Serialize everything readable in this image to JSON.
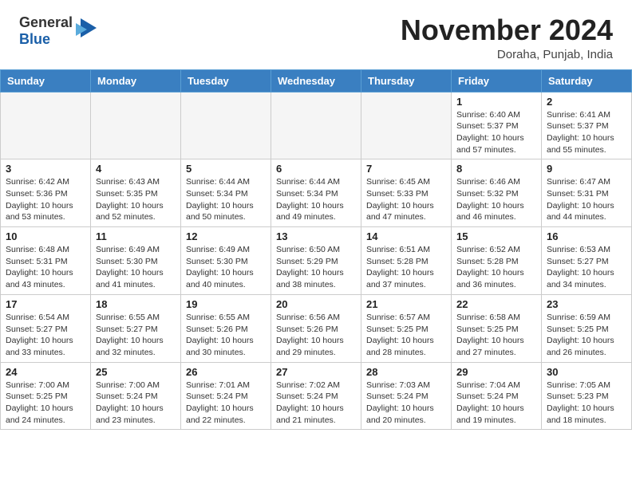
{
  "header": {
    "logo_general": "General",
    "logo_blue": "Blue",
    "month_title": "November 2024",
    "location": "Doraha, Punjab, India"
  },
  "weekdays": [
    "Sunday",
    "Monday",
    "Tuesday",
    "Wednesday",
    "Thursday",
    "Friday",
    "Saturday"
  ],
  "weeks": [
    [
      {
        "day": "",
        "info": ""
      },
      {
        "day": "",
        "info": ""
      },
      {
        "day": "",
        "info": ""
      },
      {
        "day": "",
        "info": ""
      },
      {
        "day": "",
        "info": ""
      },
      {
        "day": "1",
        "info": "Sunrise: 6:40 AM\nSunset: 5:37 PM\nDaylight: 10 hours\nand 57 minutes."
      },
      {
        "day": "2",
        "info": "Sunrise: 6:41 AM\nSunset: 5:37 PM\nDaylight: 10 hours\nand 55 minutes."
      }
    ],
    [
      {
        "day": "3",
        "info": "Sunrise: 6:42 AM\nSunset: 5:36 PM\nDaylight: 10 hours\nand 53 minutes."
      },
      {
        "day": "4",
        "info": "Sunrise: 6:43 AM\nSunset: 5:35 PM\nDaylight: 10 hours\nand 52 minutes."
      },
      {
        "day": "5",
        "info": "Sunrise: 6:44 AM\nSunset: 5:34 PM\nDaylight: 10 hours\nand 50 minutes."
      },
      {
        "day": "6",
        "info": "Sunrise: 6:44 AM\nSunset: 5:34 PM\nDaylight: 10 hours\nand 49 minutes."
      },
      {
        "day": "7",
        "info": "Sunrise: 6:45 AM\nSunset: 5:33 PM\nDaylight: 10 hours\nand 47 minutes."
      },
      {
        "day": "8",
        "info": "Sunrise: 6:46 AM\nSunset: 5:32 PM\nDaylight: 10 hours\nand 46 minutes."
      },
      {
        "day": "9",
        "info": "Sunrise: 6:47 AM\nSunset: 5:31 PM\nDaylight: 10 hours\nand 44 minutes."
      }
    ],
    [
      {
        "day": "10",
        "info": "Sunrise: 6:48 AM\nSunset: 5:31 PM\nDaylight: 10 hours\nand 43 minutes."
      },
      {
        "day": "11",
        "info": "Sunrise: 6:49 AM\nSunset: 5:30 PM\nDaylight: 10 hours\nand 41 minutes."
      },
      {
        "day": "12",
        "info": "Sunrise: 6:49 AM\nSunset: 5:30 PM\nDaylight: 10 hours\nand 40 minutes."
      },
      {
        "day": "13",
        "info": "Sunrise: 6:50 AM\nSunset: 5:29 PM\nDaylight: 10 hours\nand 38 minutes."
      },
      {
        "day": "14",
        "info": "Sunrise: 6:51 AM\nSunset: 5:28 PM\nDaylight: 10 hours\nand 37 minutes."
      },
      {
        "day": "15",
        "info": "Sunrise: 6:52 AM\nSunset: 5:28 PM\nDaylight: 10 hours\nand 36 minutes."
      },
      {
        "day": "16",
        "info": "Sunrise: 6:53 AM\nSunset: 5:27 PM\nDaylight: 10 hours\nand 34 minutes."
      }
    ],
    [
      {
        "day": "17",
        "info": "Sunrise: 6:54 AM\nSunset: 5:27 PM\nDaylight: 10 hours\nand 33 minutes."
      },
      {
        "day": "18",
        "info": "Sunrise: 6:55 AM\nSunset: 5:27 PM\nDaylight: 10 hours\nand 32 minutes."
      },
      {
        "day": "19",
        "info": "Sunrise: 6:55 AM\nSunset: 5:26 PM\nDaylight: 10 hours\nand 30 minutes."
      },
      {
        "day": "20",
        "info": "Sunrise: 6:56 AM\nSunset: 5:26 PM\nDaylight: 10 hours\nand 29 minutes."
      },
      {
        "day": "21",
        "info": "Sunrise: 6:57 AM\nSunset: 5:25 PM\nDaylight: 10 hours\nand 28 minutes."
      },
      {
        "day": "22",
        "info": "Sunrise: 6:58 AM\nSunset: 5:25 PM\nDaylight: 10 hours\nand 27 minutes."
      },
      {
        "day": "23",
        "info": "Sunrise: 6:59 AM\nSunset: 5:25 PM\nDaylight: 10 hours\nand 26 minutes."
      }
    ],
    [
      {
        "day": "24",
        "info": "Sunrise: 7:00 AM\nSunset: 5:25 PM\nDaylight: 10 hours\nand 24 minutes."
      },
      {
        "day": "25",
        "info": "Sunrise: 7:00 AM\nSunset: 5:24 PM\nDaylight: 10 hours\nand 23 minutes."
      },
      {
        "day": "26",
        "info": "Sunrise: 7:01 AM\nSunset: 5:24 PM\nDaylight: 10 hours\nand 22 minutes."
      },
      {
        "day": "27",
        "info": "Sunrise: 7:02 AM\nSunset: 5:24 PM\nDaylight: 10 hours\nand 21 minutes."
      },
      {
        "day": "28",
        "info": "Sunrise: 7:03 AM\nSunset: 5:24 PM\nDaylight: 10 hours\nand 20 minutes."
      },
      {
        "day": "29",
        "info": "Sunrise: 7:04 AM\nSunset: 5:24 PM\nDaylight: 10 hours\nand 19 minutes."
      },
      {
        "day": "30",
        "info": "Sunrise: 7:05 AM\nSunset: 5:23 PM\nDaylight: 10 hours\nand 18 minutes."
      }
    ]
  ]
}
